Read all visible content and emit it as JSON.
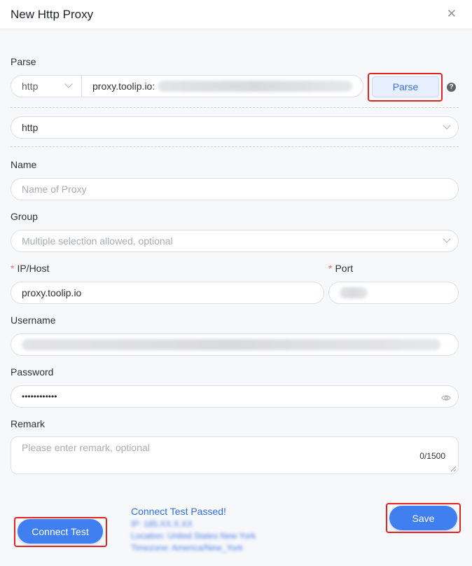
{
  "dialog": {
    "title": "New Http Proxy"
  },
  "parse": {
    "label": "Parse",
    "protocol": "http",
    "input_value": "proxy.toolip.io:",
    "button": "Parse"
  },
  "protocol_select": {
    "value": "http"
  },
  "name": {
    "label": "Name",
    "placeholder": "Name of Proxy"
  },
  "group": {
    "label": "Group",
    "placeholder": "Multiple selection allowed, optional"
  },
  "host": {
    "required_mark": "*",
    "label": "IP/Host",
    "value": "proxy.toolip.io"
  },
  "port": {
    "required_mark": "*",
    "label": "Port"
  },
  "username": {
    "label": "Username"
  },
  "password": {
    "label": "Password",
    "value": "••••••••••••"
  },
  "remark": {
    "label": "Remark",
    "placeholder": "Please enter remark, optional",
    "counter": "0/1500"
  },
  "footer": {
    "connect_test": "Connect Test",
    "status_title": "Connect Test Passed!",
    "status_lines": [
      "IP: 185.XX.X.XX",
      "Location: United States New York",
      "Timezone: America/New_York"
    ],
    "save": "Save"
  },
  "colors": {
    "primary": "#3f7ff0",
    "highlight": "#e02424"
  }
}
